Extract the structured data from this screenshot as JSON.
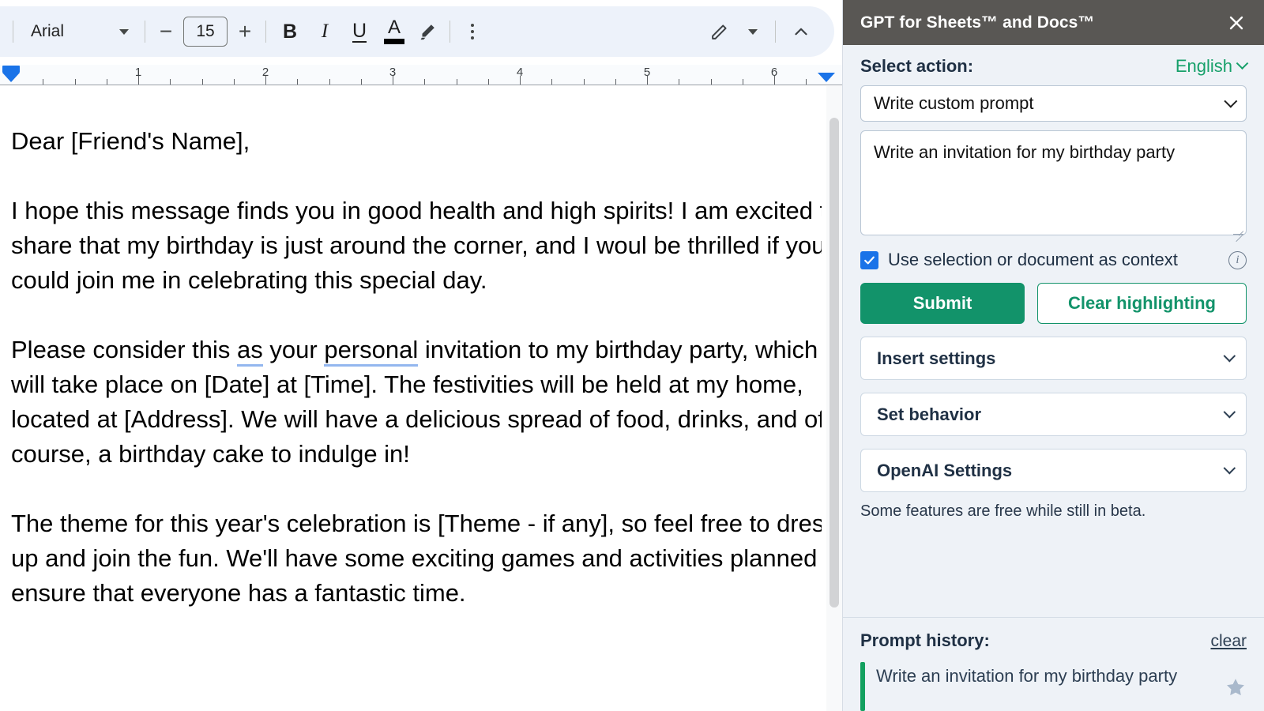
{
  "toolbar": {
    "font_name": "Arial",
    "font_size": "15",
    "decrease_label": "−",
    "increase_label": "+",
    "bold_label": "B",
    "italic_label": "I",
    "underline_label": "U",
    "text_color_label": "A",
    "highlight_icon": "highlighter-icon",
    "more_icon": "more-options-icon",
    "edit_mode_icon": "pencil-icon",
    "collapse_icon": "chevron-up-icon"
  },
  "ruler": {
    "numbers": [
      "1",
      "2",
      "3",
      "4",
      "5",
      "6"
    ],
    "left_indent_marker": "indent-marker"
  },
  "document": {
    "paragraphs": [
      {
        "id": "salutation",
        "runs": [
          {
            "text": "Dear [Friend's Name],",
            "style": "plain"
          }
        ]
      },
      {
        "id": "para-1",
        "runs": [
          {
            "text": "I hope this message finds you in good health and high spirits! I am excited to share that my birthday is just around the corner, and I woul be thrilled if you could join me in celebrating this special day.",
            "style": "plain"
          }
        ]
      },
      {
        "id": "para-2",
        "runs": [
          {
            "text": "Please consider this ",
            "style": "plain"
          },
          {
            "text": "as",
            "style": "suggestion"
          },
          {
            "text": " your ",
            "style": "plain"
          },
          {
            "text": "personal",
            "style": "suggestion"
          },
          {
            "text": " invitation to my birthday party, which will take place on [Date] at [Time]. The festivities will be held at my home, located at [Address]. We will have a delicious spread of food, drinks, and of course, a birthday cake to indulge in!",
            "style": "plain"
          }
        ]
      },
      {
        "id": "para-3",
        "runs": [
          {
            "text": "The theme for this year's celebration is [Theme - if any], so feel free to dress up and join the fun. We'll have some exciting games and activities planned to ensure that everyone has a fantastic time.",
            "style": "plain"
          }
        ]
      }
    ]
  },
  "sidebar": {
    "title": "GPT for Sheets™ and Docs™",
    "close_icon": "close-icon",
    "select_action_label": "Select action:",
    "language": "English",
    "action_select": {
      "value": "Write custom prompt",
      "options": [
        "Write custom prompt"
      ]
    },
    "prompt": {
      "value": "Write an invitation for my birthday party",
      "placeholder": ""
    },
    "context": {
      "label": "Use selection or document as context",
      "checked": true,
      "info_icon": "info-icon"
    },
    "submit_label": "Submit",
    "clear_highlighting_label": "Clear highlighting",
    "accordions": [
      {
        "label": "Insert settings"
      },
      {
        "label": "Set behavior"
      },
      {
        "label": "OpenAI Settings"
      }
    ],
    "beta_note": "Some features are free while still in beta.",
    "history": {
      "title": "Prompt history:",
      "clear_label": "clear",
      "items": [
        {
          "text": "Write an invitation for my birthday party",
          "starred": false
        }
      ]
    }
  },
  "colors": {
    "brand_green": "#12936a",
    "header_gray": "#595754",
    "sidebar_bg": "#eef2f7",
    "toolbar_bg": "#edf2fa",
    "accent_blue": "#1a73e8",
    "history_bar": "#12a05f"
  }
}
